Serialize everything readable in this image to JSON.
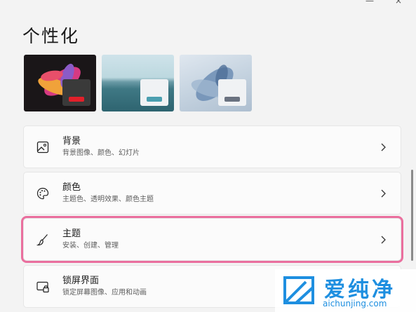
{
  "page": {
    "title": "个性化"
  },
  "themes": [
    {
      "name": "dark-bloom",
      "accent": "#e2202a"
    },
    {
      "name": "lake",
      "accent": "#4a9fb0"
    },
    {
      "name": "light-bloom",
      "accent": "#6a7280"
    }
  ],
  "items": [
    {
      "title": "背景",
      "subtitle": "背景图像、颜色、幻灯片",
      "icon": "image-icon"
    },
    {
      "title": "颜色",
      "subtitle": "主题色、透明效果、颜色主题",
      "icon": "palette-icon"
    },
    {
      "title": "主题",
      "subtitle": "安装、创建、管理",
      "icon": "brush-icon",
      "highlighted": true
    },
    {
      "title": "锁屏界面",
      "subtitle": "锁定屏幕图像、应用和动画",
      "icon": "lock-screen-icon"
    }
  ],
  "watermark": {
    "title": "爱纯净",
    "url": "aichunjing.com"
  },
  "colors": {
    "highlight": "#ea6f9e",
    "watermark": "#1e8fe0"
  }
}
